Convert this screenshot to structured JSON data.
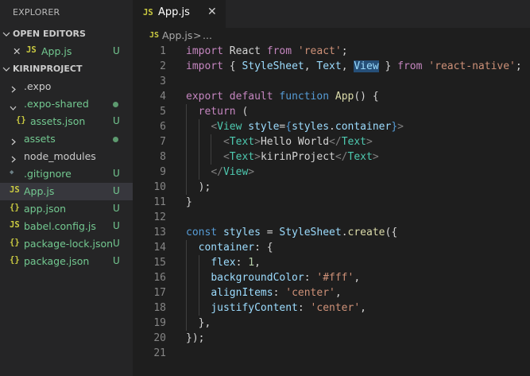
{
  "sidebar": {
    "title": "EXPLORER",
    "open_editors": {
      "label": "OPEN EDITORS",
      "files": [
        {
          "close": "✕",
          "icon": "JS",
          "name": "App.js",
          "status": "U"
        }
      ]
    },
    "project": {
      "label": "KIRINPROJECT",
      "items": [
        {
          "chevron": "›",
          "name": ".expo"
        },
        {
          "chevron": "⌄",
          "name": ".expo-shared",
          "dot": true
        },
        {
          "icon": "{}",
          "name": "assets.json",
          "status": "U"
        },
        {
          "chevron": "›",
          "name": "assets",
          "dot": true
        },
        {
          "chevron": "›",
          "name": "node_modules"
        },
        {
          "icon": "◆",
          "name": ".gitignore",
          "status": "U"
        },
        {
          "icon": "JS",
          "name": "App.js",
          "status": "U"
        },
        {
          "icon": "{}",
          "name": "app.json",
          "status": "U"
        },
        {
          "icon": "JS",
          "name": "babel.config.js",
          "status": "U"
        },
        {
          "icon": "{}",
          "name": "package-lock.json",
          "status": "U"
        },
        {
          "icon": "{}",
          "name": "package.json",
          "status": "U"
        }
      ]
    }
  },
  "tab": {
    "icon": "JS",
    "title": "App.js",
    "close": "✕"
  },
  "breadcrumb": {
    "icon": "JS",
    "file": "App.js",
    "separator": ">",
    "more": "..."
  },
  "editor": {
    "lines": [
      [
        [
          "kw",
          "import"
        ],
        [
          "pl",
          " React "
        ],
        [
          "kw",
          "from"
        ],
        [
          "pl",
          " "
        ],
        [
          "st",
          "'react'"
        ],
        [
          "pl",
          ";"
        ]
      ],
      [
        [
          "kw",
          "import"
        ],
        [
          "pl",
          " { "
        ],
        [
          "vr",
          "StyleSheet"
        ],
        [
          "pl",
          ", "
        ],
        [
          "vr",
          "Text"
        ],
        [
          "pl",
          ", "
        ],
        [
          "vr",
          "View"
        ],
        [
          "pl",
          " } "
        ],
        [
          "kw",
          "from"
        ],
        [
          "pl",
          " "
        ],
        [
          "st",
          "'react-native'"
        ],
        [
          "pl",
          ";"
        ]
      ],
      [],
      [
        [
          "kw",
          "export"
        ],
        [
          "pl",
          " "
        ],
        [
          "kw",
          "default"
        ],
        [
          "pl",
          " "
        ],
        [
          "kb",
          "function"
        ],
        [
          "pl",
          " "
        ],
        [
          "fn",
          "App"
        ],
        [
          "pl",
          "() {"
        ]
      ],
      [
        [
          "pl",
          "  "
        ],
        [
          "kw",
          "return"
        ],
        [
          "pl",
          " ("
        ]
      ],
      [
        [
          "pl",
          "    "
        ],
        [
          "tg",
          "<"
        ],
        [
          "cl",
          "View"
        ],
        [
          "pl",
          " "
        ],
        [
          "vr",
          "style"
        ],
        [
          "pl",
          "="
        ],
        [
          "kb",
          "{"
        ],
        [
          "vr",
          "styles"
        ],
        [
          "pl",
          "."
        ],
        [
          "vr",
          "container"
        ],
        [
          "kb",
          "}"
        ],
        [
          "tg",
          ">"
        ]
      ],
      [
        [
          "pl",
          "      "
        ],
        [
          "tg",
          "<"
        ],
        [
          "cl",
          "Text"
        ],
        [
          "tg",
          ">"
        ],
        [
          "pl",
          "Hello World"
        ],
        [
          "tg",
          "</"
        ],
        [
          "cl",
          "Text"
        ],
        [
          "tg",
          ">"
        ]
      ],
      [
        [
          "pl",
          "      "
        ],
        [
          "tg",
          "<"
        ],
        [
          "cl",
          "Text"
        ],
        [
          "tg",
          ">"
        ],
        [
          "pl",
          "kirinProject"
        ],
        [
          "tg",
          "</"
        ],
        [
          "cl",
          "Text"
        ],
        [
          "tg",
          ">"
        ]
      ],
      [
        [
          "pl",
          "    "
        ],
        [
          "tg",
          "</"
        ],
        [
          "cl",
          "View"
        ],
        [
          "tg",
          ">"
        ]
      ],
      [
        [
          "pl",
          "  );"
        ]
      ],
      [
        [
          "pl",
          "}"
        ]
      ],
      [],
      [
        [
          "kb",
          "const"
        ],
        [
          "pl",
          " "
        ],
        [
          "vr",
          "styles"
        ],
        [
          "pl",
          " = "
        ],
        [
          "vr",
          "StyleSheet"
        ],
        [
          "pl",
          "."
        ],
        [
          "fn",
          "create"
        ],
        [
          "pl",
          "({"
        ]
      ],
      [
        [
          "pl",
          "  "
        ],
        [
          "vr",
          "container"
        ],
        [
          "pl",
          ": {"
        ]
      ],
      [
        [
          "pl",
          "    "
        ],
        [
          "vr",
          "flex"
        ],
        [
          "pl",
          ": "
        ],
        [
          "nm",
          "1"
        ],
        [
          "pl",
          ","
        ]
      ],
      [
        [
          "pl",
          "    "
        ],
        [
          "vr",
          "backgroundColor"
        ],
        [
          "pl",
          ": "
        ],
        [
          "st",
          "'#fff'"
        ],
        [
          "pl",
          ","
        ]
      ],
      [
        [
          "pl",
          "    "
        ],
        [
          "vr",
          "alignItems"
        ],
        [
          "pl",
          ": "
        ],
        [
          "st",
          "'center'"
        ],
        [
          "pl",
          ","
        ]
      ],
      [
        [
          "pl",
          "    "
        ],
        [
          "vr",
          "justifyContent"
        ],
        [
          "pl",
          ": "
        ],
        [
          "st",
          "'center'"
        ],
        [
          "pl",
          ","
        ]
      ],
      [
        [
          "pl",
          "  },"
        ]
      ],
      [
        [
          "pl",
          "});"
        ]
      ],
      []
    ],
    "selected_token": {
      "line": 2,
      "text": "View"
    }
  },
  "colors": {
    "keyword": "#c586c0",
    "string": "#ce9178",
    "storage": "#569cd6",
    "function": "#dcdcaa",
    "variable": "#9cdcfe",
    "component": "#4ec9b0",
    "untracked": "#73c991"
  }
}
